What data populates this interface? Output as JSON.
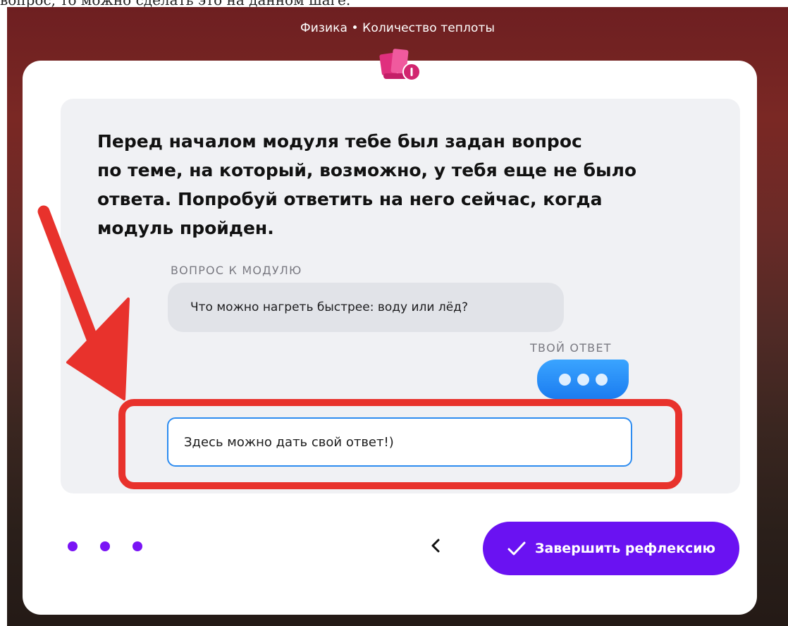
{
  "top_fragment": "вопрос, то можно сделать это на данном шаге.",
  "header": {
    "subject": "Физика • Количество теплоты"
  },
  "module_icon": "module-logo-icon",
  "prompt": {
    "lines": [
      "Перед началом модуля тебе был задан вопрос",
      "по теме, на который, возможно, у тебя еще не было",
      "ответа. Попробуй ответить на него сейчас, когда",
      "модуль пройден."
    ]
  },
  "chat": {
    "question_label": "ВОПРОС К МОДУЛЮ",
    "question_text": "Что можно нагреть быстрее: воду или лёд?",
    "answer_label": "ТВОЙ ОТВЕТ",
    "typing_icon": "typing-indicator-icon"
  },
  "answer_input": {
    "value": "Здесь можно дать свой ответ!)"
  },
  "footer": {
    "step_count": 3,
    "back_icon": "chevron-left-icon",
    "finish_label": "Завершить рефлексию",
    "finish_icon": "checkmark-icon"
  },
  "colors": {
    "accent": "#6a12f2",
    "chat_bubble": "#1b7cf0",
    "input_border": "#2d8cf0",
    "annotation_red": "#e8322c"
  }
}
